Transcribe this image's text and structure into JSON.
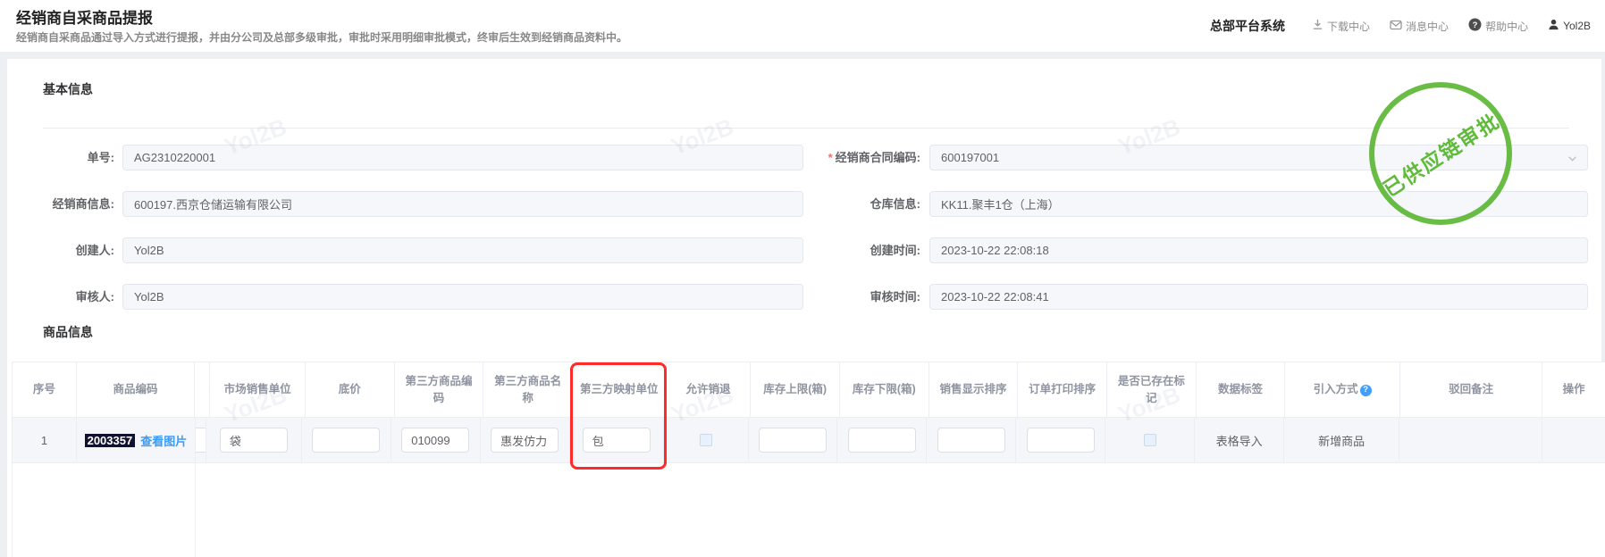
{
  "header": {
    "title": "经销商自采商品提报",
    "subtitle": "经销商自采商品通过导入方式进行提报，并由分公司及总部多级审批，审批时采用明细审批模式，终审后生效到经销商品资料中。",
    "system_name": "总部平台系统",
    "nav": [
      {
        "icon": "download-icon",
        "label": "下载中心"
      },
      {
        "icon": "message-icon",
        "label": "消息中心"
      },
      {
        "icon": "help-icon",
        "label": "帮助中心"
      },
      {
        "icon": "user-icon",
        "label": "Yol2B"
      }
    ]
  },
  "watermark": {
    "text": "Yol2B"
  },
  "stamp": {
    "text": "已供应链审批",
    "color": "#54b42b"
  },
  "basic": {
    "title": "基本信息",
    "required_mark": "*",
    "rows": [
      {
        "left": {
          "label": "单号:",
          "value": "AG2310220001"
        },
        "right": {
          "label": "经销商合同编码:",
          "value": "600197001",
          "required": true,
          "type": "select"
        }
      },
      {
        "left": {
          "label": "经销商信息:",
          "value": "600197.西京仓储运输有限公司"
        },
        "right": {
          "label": "仓库信息:",
          "value": "KK11.聚丰1仓（上海）"
        }
      },
      {
        "left": {
          "label": "创建人:",
          "value": "Yol2B"
        },
        "right": {
          "label": "创建时间:",
          "value": "2023-10-22 22:08:18"
        }
      },
      {
        "left": {
          "label": "审核人:",
          "value": "Yol2B"
        },
        "right": {
          "label": "审核时间:",
          "value": "2023-10-22 22:08:41"
        }
      }
    ]
  },
  "products": {
    "title": "商品信息",
    "help_mark": "?",
    "columns": [
      {
        "label": "序号"
      },
      {
        "label": "商品编码"
      },
      {
        "label": ""
      },
      {
        "label": "市场销售单位"
      },
      {
        "label": "底价"
      },
      {
        "label": "第三方商品编码"
      },
      {
        "label": "第三方商品名称"
      },
      {
        "label": "第三方映射单位"
      },
      {
        "label": "允许销退"
      },
      {
        "label": "库存上限(箱)"
      },
      {
        "label": "库存下限(箱)"
      },
      {
        "label": "销售显示排序"
      },
      {
        "label": "订单打印排序"
      },
      {
        "label": "是否已存在标记"
      },
      {
        "label": "数据标签"
      },
      {
        "label": "引入方式"
      },
      {
        "label": "驳回备注"
      },
      {
        "label": "操作"
      }
    ],
    "row": {
      "index": "1",
      "product_code": "2003357",
      "view_image": "查看图片",
      "market_unit": "袋",
      "floor_price": "",
      "third_party_code": "010099",
      "third_party_name": "惠发仿力",
      "third_party_unit": "包",
      "stock_upper": "",
      "stock_lower": "",
      "sale_sort": "",
      "print_sort": "",
      "data_tag": "表格导入",
      "import_way": "新增商品",
      "reject_remark": "",
      "action": ""
    },
    "colors": {
      "highlight_box": "#ff2b2b",
      "link": "#409eff",
      "selection_bg": "#10122e"
    }
  }
}
